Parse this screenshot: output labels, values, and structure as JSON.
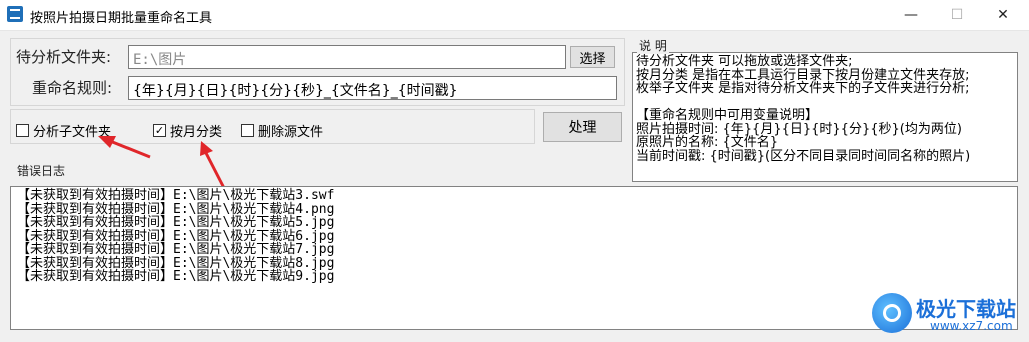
{
  "window": {
    "title": "按照片拍摄日期批量重命名工具",
    "minimize_glyph": "—",
    "maximize_glyph": "☐",
    "close_glyph": "✕"
  },
  "form": {
    "folder_label": "待分析文件夹:",
    "folder_value": "E:\\图片",
    "select_button": "选择",
    "rule_label": "重命名规则:",
    "rule_value": "{年}{月}{日}{时}{分}{秒}_{文件名}_{时间戳}",
    "process_button": "处理"
  },
  "options": [
    {
      "label": "分析子文件夹",
      "checked": false
    },
    {
      "label": "按月分类",
      "checked": true
    },
    {
      "label": "删除源文件",
      "checked": false
    }
  ],
  "notes": {
    "title": "说 明",
    "lines": [
      "待分析文件夹 可以拖放或选择文件夹;",
      "按月分类 是指在本工具运行目录下按月份建立文件夹存放;",
      "枚举子文件夹 是指对待分析文件夹下的子文件夹进行分析;",
      "",
      "【重命名规则中可用变量说明】",
      "照片拍摄时间: {年}{月}{日}{时}{分}{秒}(均为两位)",
      "原照片的名称: {文件名}",
      "当前时间戳: {时间戳}(区分不同目录同时间同名称的照片)"
    ]
  },
  "log": {
    "label": "错误日志",
    "lines": [
      "【未获取到有效拍摄时间】E:\\图片\\极光下载站3.swf",
      "【未获取到有效拍摄时间】E:\\图片\\极光下载站4.png",
      "【未获取到有效拍摄时间】E:\\图片\\极光下载站5.jpg",
      "【未获取到有效拍摄时间】E:\\图片\\极光下载站6.jpg",
      "【未获取到有效拍摄时间】E:\\图片\\极光下载站7.jpg",
      "【未获取到有效拍摄时间】E:\\图片\\极光下载站8.jpg",
      "【未获取到有效拍摄时间】E:\\图片\\极光下载站9.jpg"
    ]
  },
  "watermark": {
    "name": "极光下载站",
    "url": "www.xz7.com"
  },
  "colors": {
    "arrow": "#e0262a",
    "accent": "#1b6fd8"
  }
}
